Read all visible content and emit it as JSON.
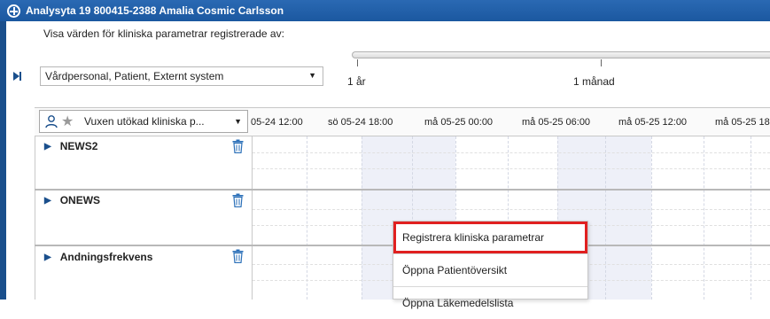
{
  "window": {
    "title": "Analysyta 19 800415-2388 Amalia Cosmic Carlsson"
  },
  "filter": {
    "label": "Visa värden för kliniska parametrar registrerade av:",
    "selected": "Vårdpersonal, Patient, Externt system"
  },
  "timescale": {
    "ticks": [
      "1 år",
      "1 månad"
    ]
  },
  "template": {
    "selected": "Vuxen utökad kliniska p..."
  },
  "timeline": {
    "labels": [
      "05-24 12:00",
      "sö 05-24 18:00",
      "må 05-25 00:00",
      "må 05-25 06:00",
      "må 05-25 12:00",
      "må 05-25 18"
    ]
  },
  "parameters": [
    {
      "name": "NEWS2"
    },
    {
      "name": "ONEWS"
    },
    {
      "name": "Andningsfrekvens"
    }
  ],
  "context_menu": {
    "items": [
      "Registrera kliniska parametrar",
      "Öppna Patientöversikt",
      "Öppna Läkemedelslista"
    ]
  },
  "colors": {
    "title_bar": "#1b58a0",
    "highlight_border": "#e02020",
    "grid_shade": "#eef0f8"
  },
  "icons": {
    "title": "plus-circle-icon",
    "expand": "expand-right-icon",
    "person": "person-icon",
    "favorite": "star-icon",
    "delete": "trash-icon",
    "row_expand": "triangle-right-icon"
  }
}
